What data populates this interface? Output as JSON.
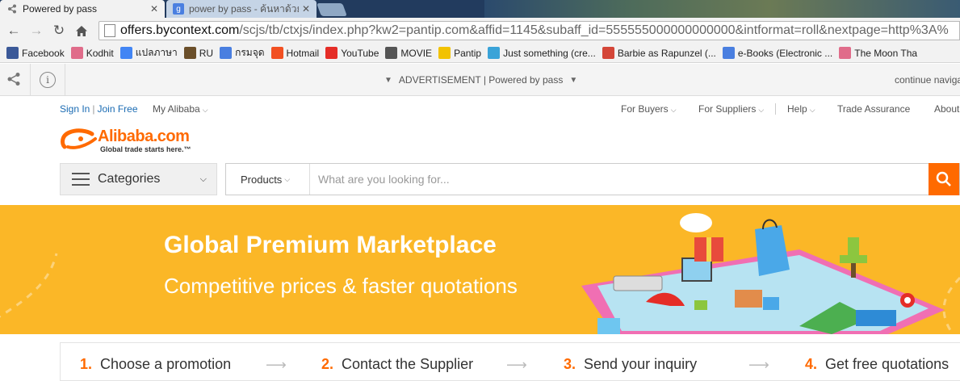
{
  "browser": {
    "tabs": [
      {
        "title": "Powered by pass",
        "active": true
      },
      {
        "title": "power by pass - ค้นหาด้วย G",
        "active": false
      }
    ],
    "url": {
      "host": "offers.bycontext.com",
      "path": "/scjs/tb/ctxjs/index.php?kw2=pantip.com&affid=1145&subaff_id=555555000000000000&intformat=roll&nextpage=http%3A%"
    },
    "bookmarks": [
      {
        "label": "Facebook",
        "icon": "facebook-icon",
        "color": "#3b5998"
      },
      {
        "label": "Kodhit",
        "icon": "heart-icon",
        "color": "#e06c8a"
      },
      {
        "label": "แปลภาษา",
        "icon": "translate-icon",
        "color": "#4285f4"
      },
      {
        "label": "RU",
        "icon": "ru-icon",
        "color": "#6b4f2a"
      },
      {
        "label": "กรมจุด",
        "icon": "google-icon",
        "color": "#4a7fe0"
      },
      {
        "label": "Hotmail",
        "icon": "windows-icon",
        "color": "#f25022"
      },
      {
        "label": "YouTube",
        "icon": "youtube-icon",
        "color": "#e52d27"
      },
      {
        "label": "MOVIE",
        "icon": "film-icon",
        "color": "#555555"
      },
      {
        "label": "Pantip",
        "icon": "smiley-icon",
        "color": "#f2c200"
      },
      {
        "label": "Just something (cre...",
        "icon": "globe-icon",
        "color": "#3aa3d8"
      },
      {
        "label": "Barbie as Rapunzel (...",
        "icon": "gmail-icon",
        "color": "#d44638"
      },
      {
        "label": "e-Books (Electronic ...",
        "icon": "google-icon",
        "color": "#4a7fe0"
      },
      {
        "label": "The Moon Tha",
        "icon": "heart-icon",
        "color": "#e06c8a"
      }
    ]
  },
  "adbar": {
    "label": "ADVERTISEMENT | Powered by pass",
    "continue": "continue navigat"
  },
  "alibaba": {
    "signin": "Sign In",
    "join": "Join Free",
    "my_alibaba": "My Alibaba",
    "nav": [
      {
        "label": "For Buyers",
        "chevron": true
      },
      {
        "label": "For Suppliers",
        "chevron": true
      },
      {
        "label": "Help",
        "chevron": true
      },
      {
        "label": "Trade Assurance",
        "chevron": false
      },
      {
        "label": "About",
        "chevron": false
      }
    ],
    "logo": {
      "word": "Alibaba.com",
      "tagline": "Global trade starts here.™"
    },
    "categories_label": "Categories",
    "search": {
      "scope": "Products",
      "placeholder": "What are you looking for..."
    },
    "banner": {
      "title": "Global Premium Marketplace",
      "subtitle": "Competitive prices & faster quotations"
    },
    "steps": [
      {
        "num": "1.",
        "label": "Choose a promotion"
      },
      {
        "num": "2.",
        "label": "Contact the Supplier"
      },
      {
        "num": "3.",
        "label": "Send your inquiry"
      },
      {
        "num": "4.",
        "label": "Get free quotations"
      }
    ]
  },
  "colors": {
    "brand": "#ff6a00",
    "banner": "#fbb727",
    "link": "#1a6bb3"
  }
}
